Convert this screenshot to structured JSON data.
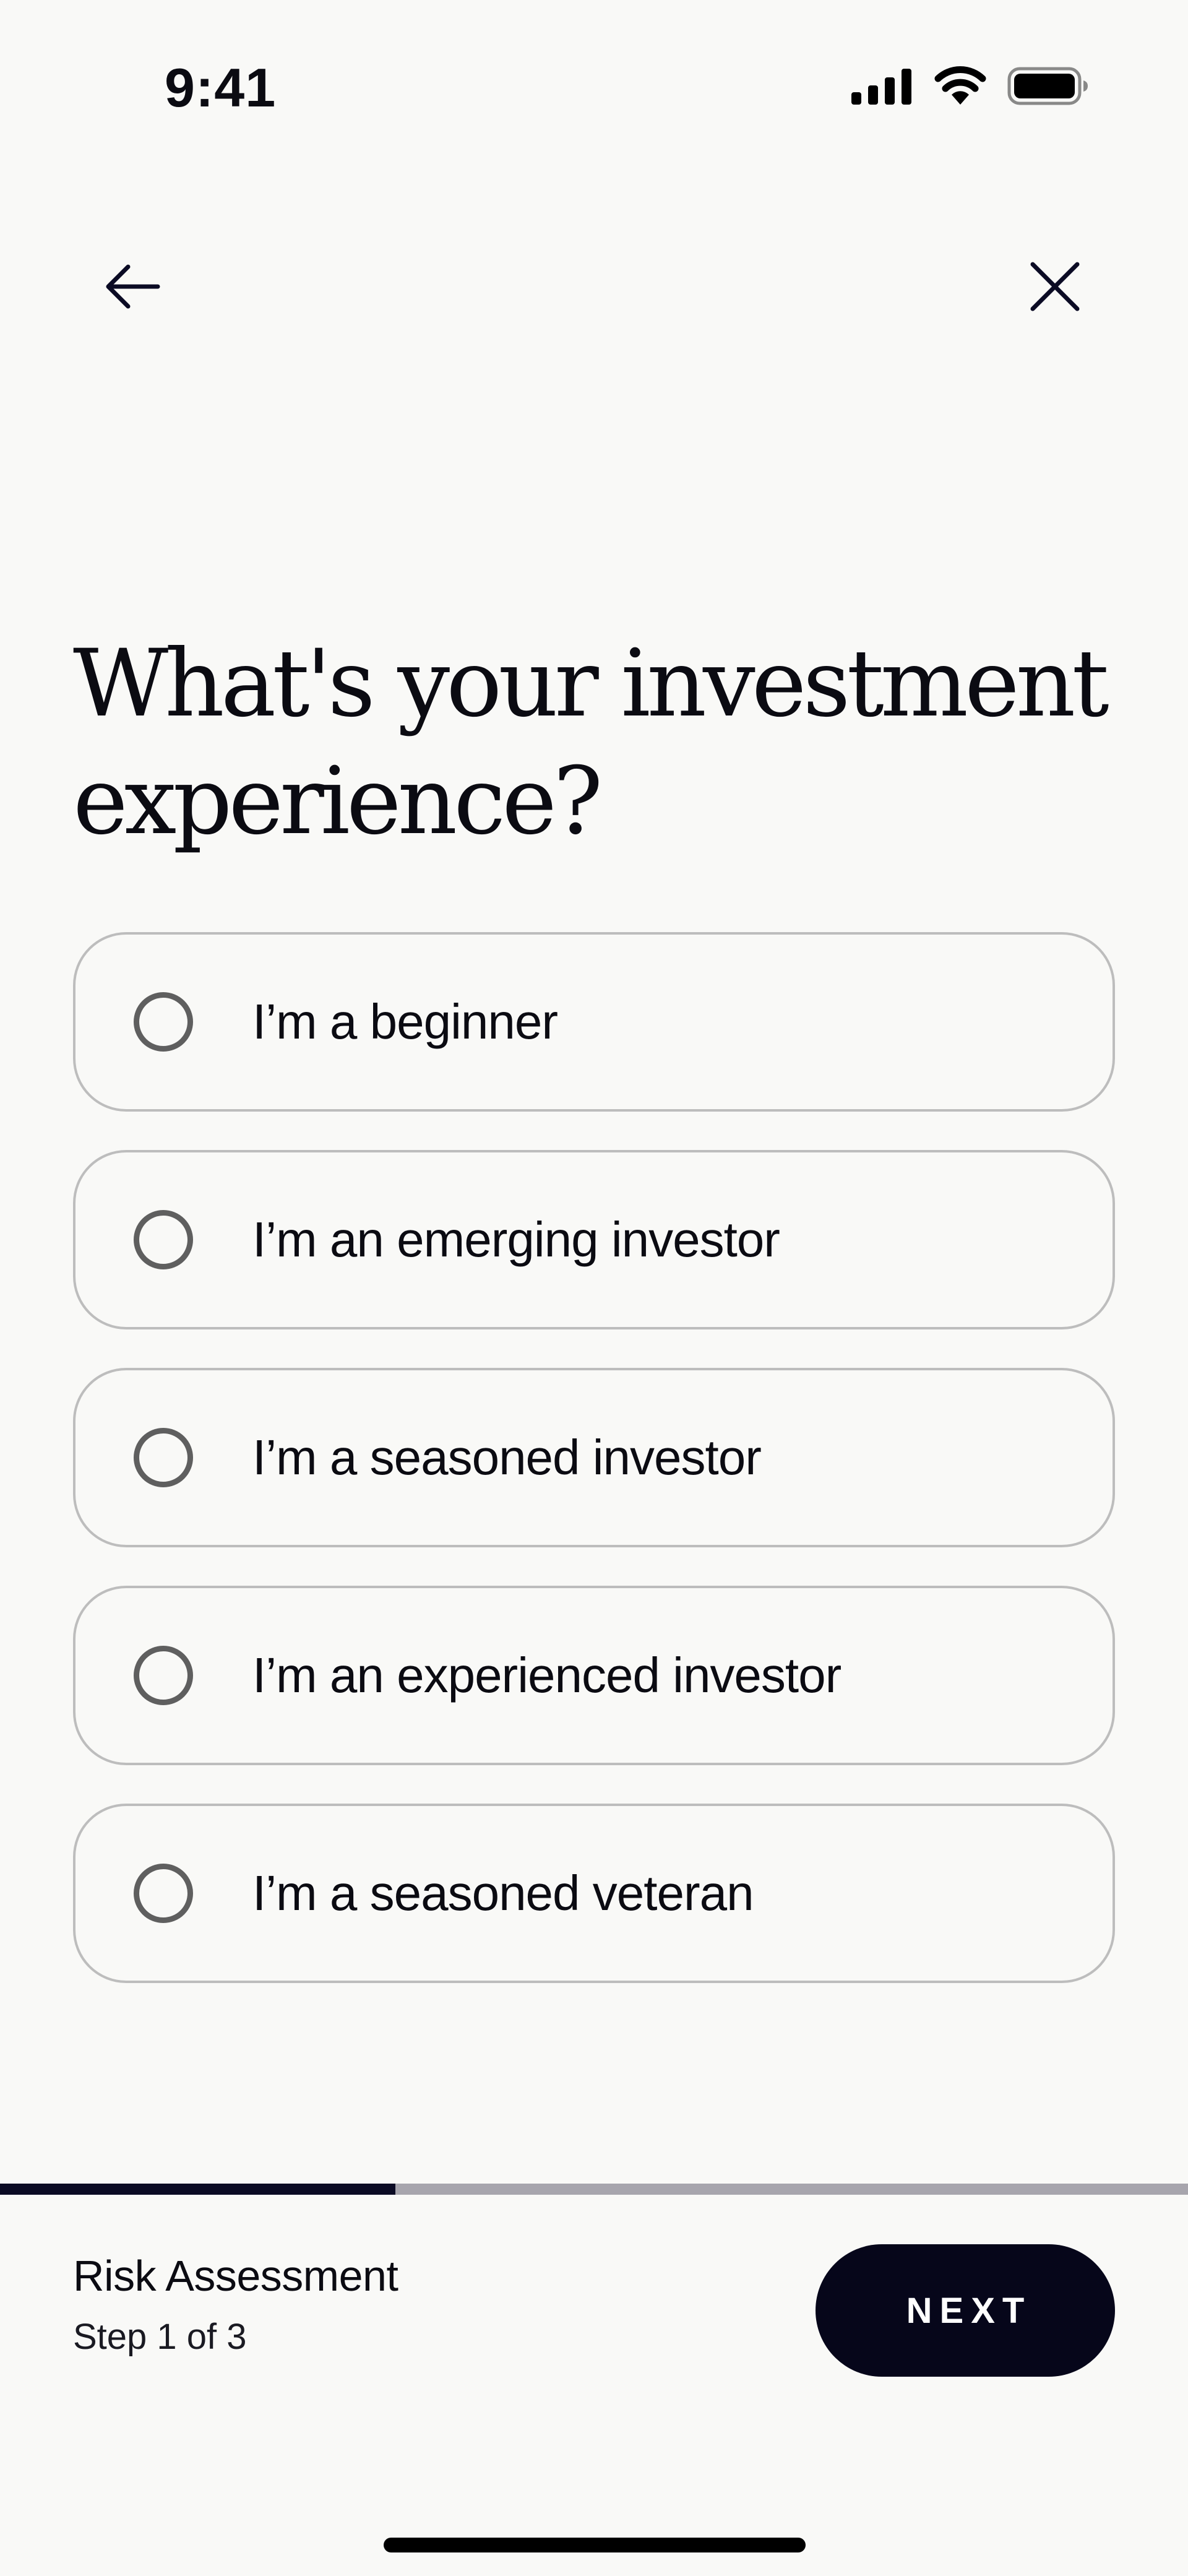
{
  "status_bar": {
    "time": "9:41",
    "icons": [
      "cellular-signal-icon",
      "wifi-icon",
      "battery-icon"
    ]
  },
  "nav": {
    "back_icon": "arrow-left-icon",
    "close_icon": "close-icon"
  },
  "question": {
    "title": "What's your investment experience?"
  },
  "options": [
    {
      "label": "I’m a beginner",
      "selected": false
    },
    {
      "label": "I’m an emerging investor",
      "selected": false
    },
    {
      "label": "I’m a seasoned investor",
      "selected": false
    },
    {
      "label": "I’m an experienced investor",
      "selected": false
    },
    {
      "label": "I’m a seasoned veteran",
      "selected": false
    }
  ],
  "progress": {
    "fraction": 0.333
  },
  "footer": {
    "title": "Risk Assessment",
    "step": "Step 1 of 3",
    "next_label": "NEXT"
  },
  "colors": {
    "background": "#f9f9f7",
    "primary": "#06061a",
    "progress_fill": "#0b0b24",
    "progress_track": "#a7a5ad",
    "option_border": "#bdbdbd",
    "radio_border": "#5f5f5f"
  }
}
